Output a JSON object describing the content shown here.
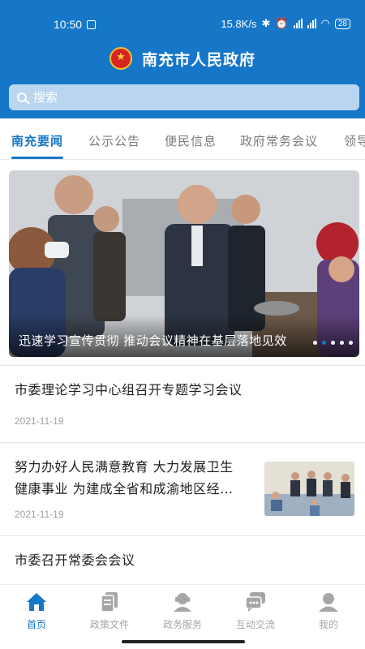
{
  "status_bar": {
    "time": "10:50",
    "network_speed": "15.8K/s",
    "battery": "28"
  },
  "header": {
    "app_title": "南充市人民政府",
    "emblem_icon": "national-emblem-icon"
  },
  "search": {
    "placeholder": "搜索"
  },
  "tabs": [
    {
      "label": "南充要闻",
      "active": true
    },
    {
      "label": "公示公告",
      "active": false
    },
    {
      "label": "便民信息",
      "active": false
    },
    {
      "label": "政府常务会议",
      "active": false
    },
    {
      "label": "领导",
      "active": false
    }
  ],
  "banner": {
    "caption": "迅速学习宣传贯彻  推动会议精神在基层落地见效",
    "slide_count": 5,
    "active_slide": 2
  },
  "news": [
    {
      "title": "市委理论学习中心组召开专题学习会议",
      "date": "2021-11-19",
      "has_thumbnail": false
    },
    {
      "title_line1": "努力办好人民满意教育  大力发展卫生",
      "title_line2": "健康事业  为建成全省和成渝地区经…",
      "date": "2021-11-19",
      "has_thumbnail": true
    },
    {
      "title": "市委召开常委会会议"
    }
  ],
  "bottom_nav": [
    {
      "label": "首页",
      "icon": "home-icon",
      "active": true
    },
    {
      "label": "政策文件",
      "icon": "documents-icon",
      "active": false
    },
    {
      "label": "政务服务",
      "icon": "service-person-icon",
      "active": false
    },
    {
      "label": "互动交流",
      "icon": "chat-icon",
      "active": false
    },
    {
      "label": "我的",
      "icon": "profile-icon",
      "active": false
    }
  ],
  "colors": {
    "primary": "#1677c8",
    "inactive": "#a6a6a6"
  }
}
